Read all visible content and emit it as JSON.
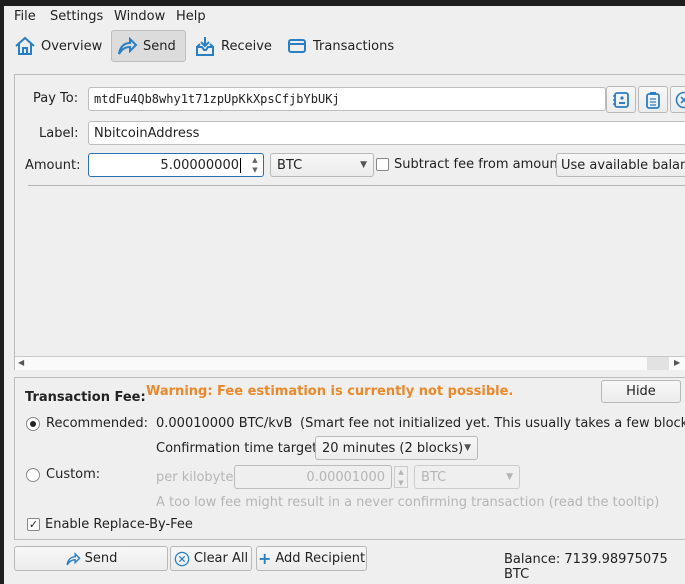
{
  "menu": {
    "items": [
      "File",
      "Settings",
      "Window",
      "Help"
    ]
  },
  "toolbar": {
    "overview": "Overview",
    "send": "Send",
    "receive": "Receive",
    "transactions": "Transactions"
  },
  "recipient": {
    "pay_to_label": "Pay To:",
    "pay_to_value": "mtdFu4Qb8why1t71zpUpKkXpsCfjbYbUKj",
    "label_label": "Label:",
    "label_value": "NbitcoinAddress",
    "amount_label": "Amount:",
    "amount_value": "5.00000000",
    "unit": "BTC",
    "subtract_fee_label": "Subtract fee from amount",
    "subtract_fee_checked": false,
    "use_balance_label": "Use available balance"
  },
  "fee": {
    "title": "Transaction Fee:",
    "warning": "Warning: Fee estimation is currently not possible.",
    "warning_color": "#e8892b",
    "hide_label": "Hide",
    "recommended_label": "Recommended:",
    "recommended_value": "0.00010000 BTC/kvB",
    "recommended_note": "(Smart fee not initialized yet. This usually takes a few blocks...)",
    "conf_target_label": "Confirmation time target:",
    "conf_target_value": "20 minutes (2 blocks)",
    "custom_label": "Custom:",
    "per_kb_label": "per kilobyte",
    "custom_value": "0.00001000",
    "custom_unit": "BTC",
    "low_fee_note": "A too low fee might result in a never confirming transaction (read the tooltip)",
    "rbf_label": "Enable Replace-By-Fee",
    "rbf_checked": true
  },
  "actions": {
    "send": "Send",
    "clear_all": "Clear All",
    "add_recipient": "Add Recipient"
  },
  "balance": "Balance: 7139.98975075 BTC"
}
